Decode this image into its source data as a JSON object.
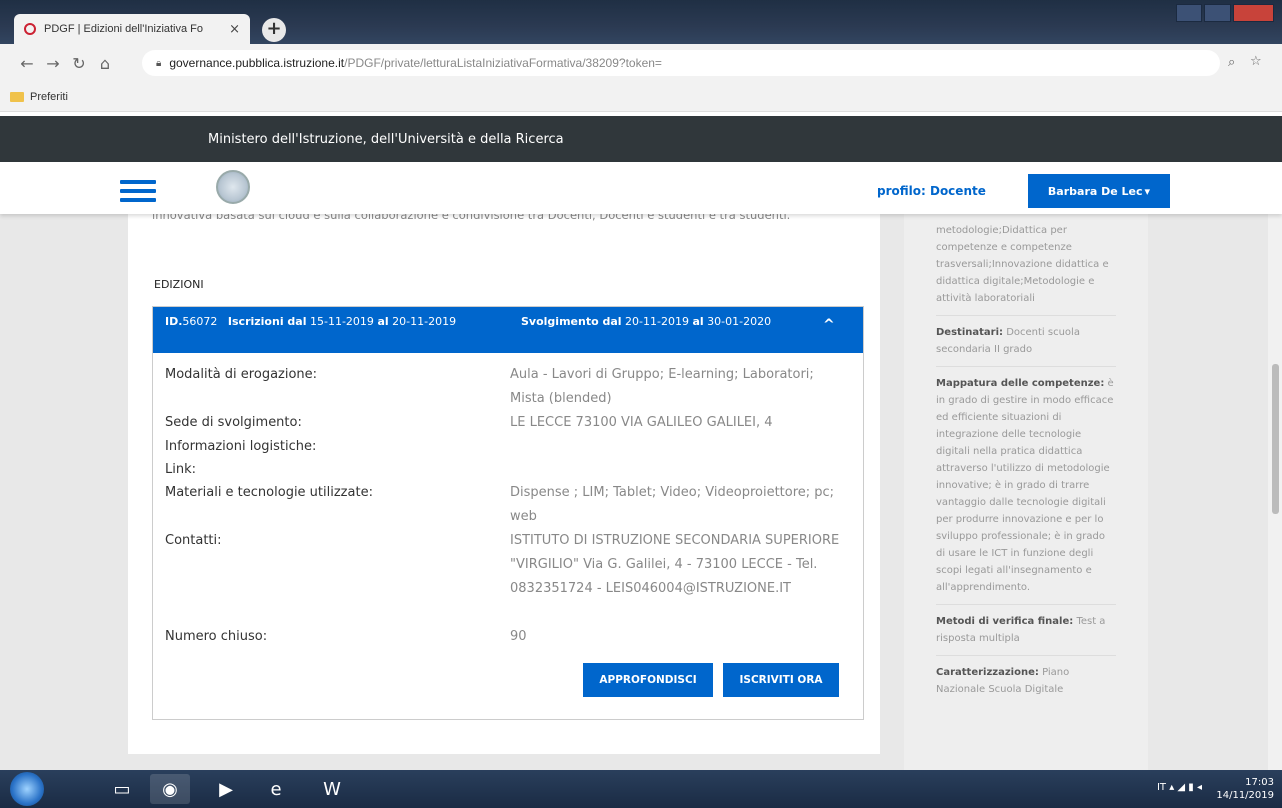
{
  "browser": {
    "tab_title": "PDGF | Edizioni dell'Iniziativa Fo",
    "tab_close": "×",
    "new_tab": "+",
    "url_host": "governance.pubblica.istruzione.it",
    "url_path": "/PDGF/private/letturaListaIniziativaFormativa/38209?token=",
    "bookmarks_label": "Preferiti"
  },
  "site": {
    "ministry": "Ministero dell'Istruzione, dell'Università e della Ricerca",
    "profile_label": "profilo: Docente",
    "user_name": "Barbara De Lec"
  },
  "main": {
    "intro_text": "innovativa basata sul cloud e sulla collaborazione e condivisione tra Docenti, Docenti e studenti e tra studenti.",
    "edizioni_label": "EDIZIONI",
    "edition": {
      "id_label": "ID.",
      "id": "56072",
      "iscrizioni_label": "Iscrizioni dal",
      "iscrizioni_from": "15-11-2019",
      "al1": "al",
      "iscrizioni_to": "20-11-2019",
      "svolgimento_label": "Svolgimento dal",
      "svolgimento_from": "20-11-2019",
      "al2": "al",
      "svolgimento_to": "30-01-2020"
    },
    "details": [
      {
        "label": "Modalità di erogazione:",
        "value": "Aula - Lavori di Gruppo; E-learning; Laboratori; Mista (blended)"
      },
      {
        "label": "Sede di svolgimento:",
        "value": "LE LECCE 73100 VIA GALILEO GALILEI, 4"
      },
      {
        "label": "Informazioni logistiche:",
        "value": ""
      },
      {
        "label": "Link:",
        "value": ""
      },
      {
        "label": "Materiali e tecnologie utilizzate:",
        "value": "Dispense ; LIM; Tablet; Video; Videoproiettore; pc; web"
      },
      {
        "label": "Contatti:",
        "value": "ISTITUTO DI ISTRUZIONE SECONDARIA SUPERIORE \"VIRGILIO\" Via G. Galilei, 4 - 73100 LECCE - Tel. 0832351724 - LEIS046004@ISTRUZIONE.IT"
      },
      {
        "label": "Numero chiuso:",
        "value": "90"
      }
    ],
    "btn_approfondisci": "APPROFONDISCI",
    "btn_iscriviti": "ISCRIVITI ORA"
  },
  "sidebar": {
    "s1": "metodologie;Didattica per competenze e competenze trasversali;Innovazione didattica e didattica digitale;Metodologie e attività laboratoriali",
    "destinatari_label": "Destinatari:",
    "destinatari": "Docenti scuola secondaria II grado",
    "mappatura_label": "Mappatura delle competenze:",
    "mappatura": "è in grado di gestire in modo efficace ed efficiente situazioni di integrazione delle tecnologie digitali nella pratica didattica attraverso l'utilizzo di metodologie innovative; è in grado di trarre vantaggio dalle tecnologie digitali per produrre innovazione e per lo sviluppo professionale; è in grado di usare le ICT in funzione degli scopi legati all'insegnamento e all'apprendimento.",
    "metodi_label": "Metodi di verifica finale:",
    "metodi": "Test a risposta multipla",
    "caratt_label": "Caratterizzazione:",
    "caratt": "Piano Nazionale Scuola Digitale"
  },
  "taskbar": {
    "lang": "IT",
    "time": "17:03",
    "date": "14/11/2019"
  }
}
